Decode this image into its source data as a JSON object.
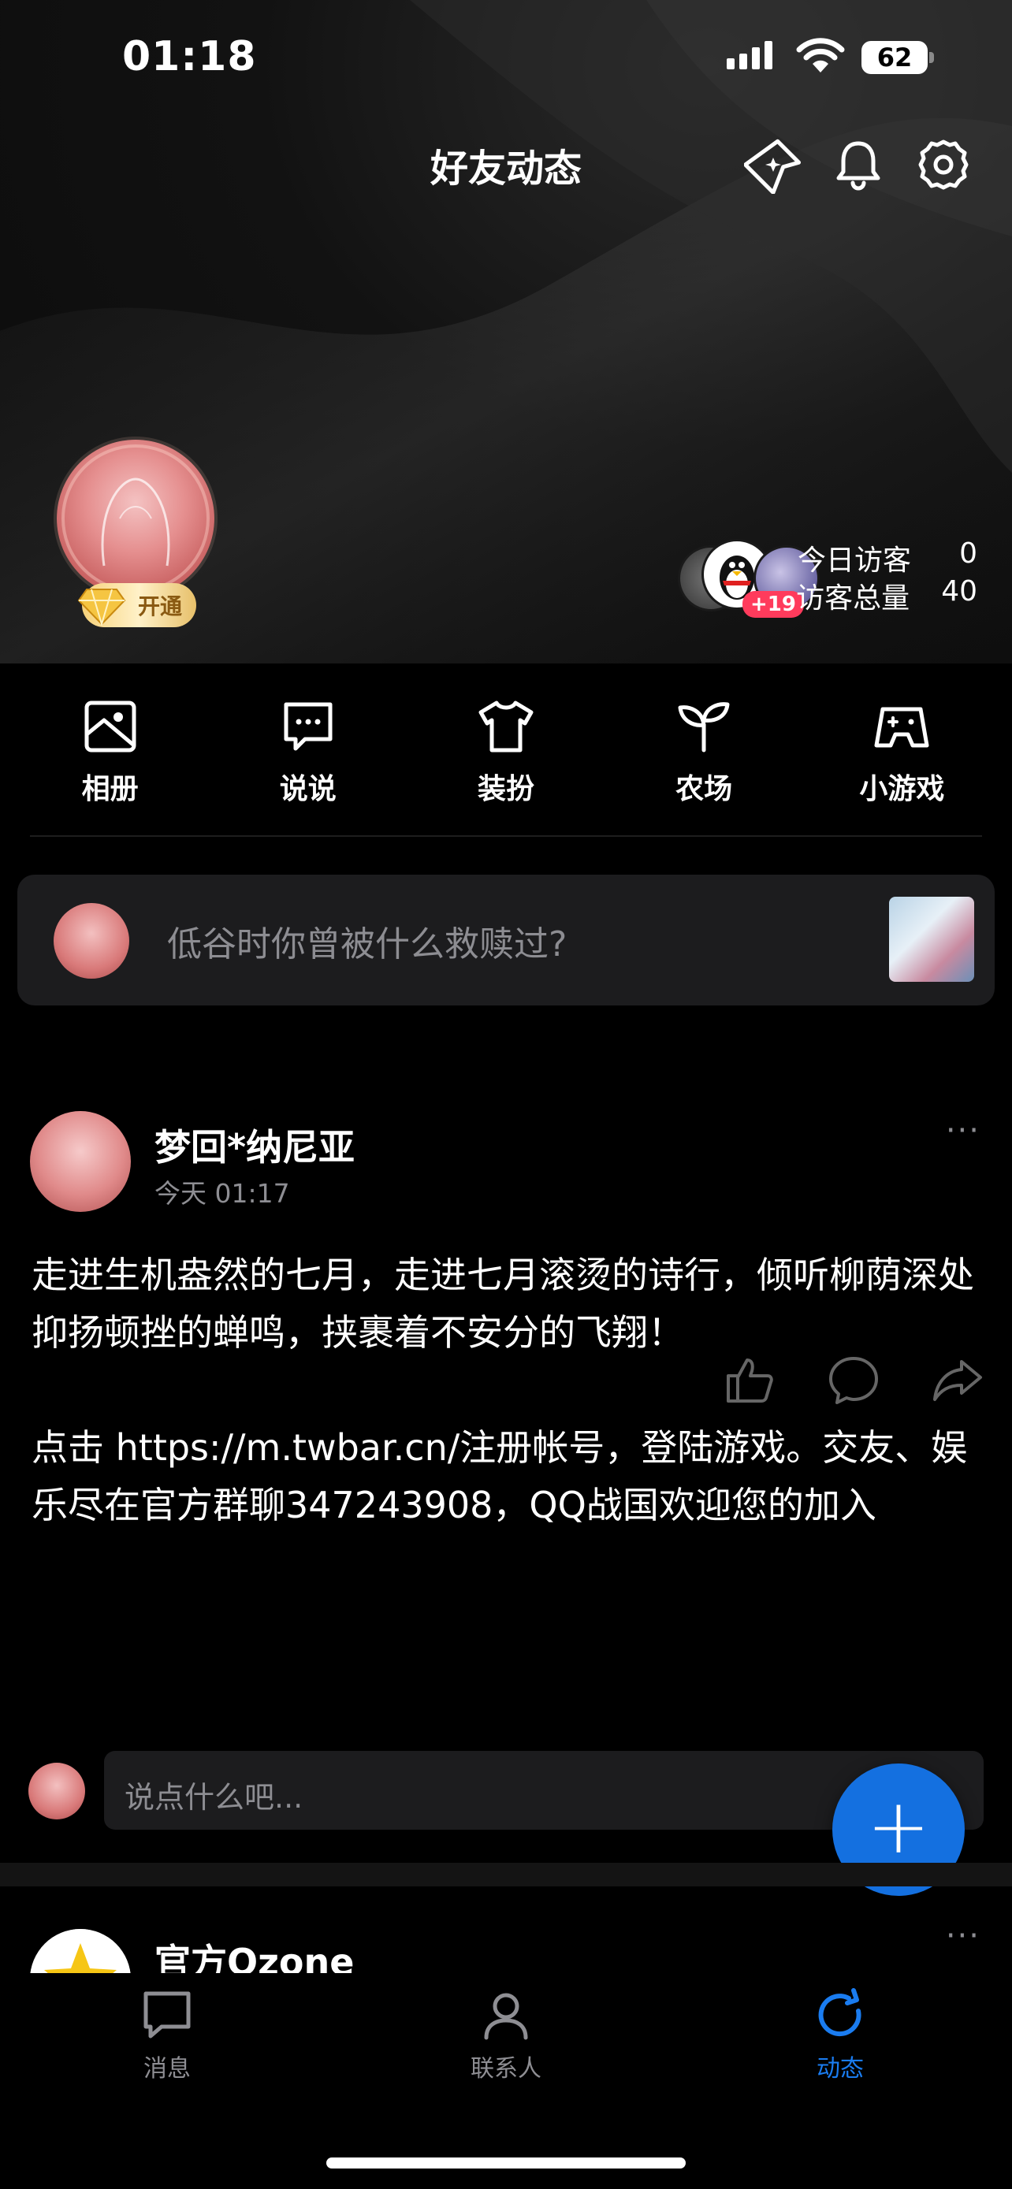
{
  "status_bar": {
    "time": "01:18",
    "battery": "62"
  },
  "nav": {
    "title": "好友动态"
  },
  "profile": {
    "vip_label": "开通"
  },
  "visitors": {
    "extra": "+19",
    "today_label": "今日访客",
    "today_value": "0",
    "total_label": "访客总量",
    "total_value": "40"
  },
  "entries": [
    {
      "label": "相册",
      "icon": "photo-album-icon"
    },
    {
      "label": "说说",
      "icon": "chat-bubble-icon"
    },
    {
      "label": "装扮",
      "icon": "shirt-icon"
    },
    {
      "label": "农场",
      "icon": "sprout-icon"
    },
    {
      "label": "小游戏",
      "icon": "gamepad-icon"
    }
  ],
  "composer": {
    "prompt": "低谷时你曾被什么救赎过?"
  },
  "post": {
    "author": "梦回*纳尼亚",
    "time": "今天 01:17",
    "more": "···",
    "body": "走进生机盎然的七月，走进七月滚烫的诗行，倾听柳荫深处抑扬顿挫的蝉鸣，挟裹着不安分的飞翔！\n\n点击 https://m.twbar.cn/注册帐号，登陆游戏。交友、娱乐尽在官方群聊347243908，QQ战国欢迎您的加入"
  },
  "comment": {
    "placeholder": "说点什么吧..."
  },
  "post2": {
    "author": "官方Qzone",
    "more": "···"
  },
  "tabs": [
    {
      "label": "消息",
      "icon": "message-icon"
    },
    {
      "label": "联系人",
      "icon": "contacts-icon"
    },
    {
      "label": "动态",
      "icon": "refresh-icon",
      "active": true
    }
  ],
  "colors": {
    "accent": "#1470e0",
    "tab_active": "#1a7cf0",
    "muted": "#8e8e93",
    "card": "#1c1c1e"
  }
}
